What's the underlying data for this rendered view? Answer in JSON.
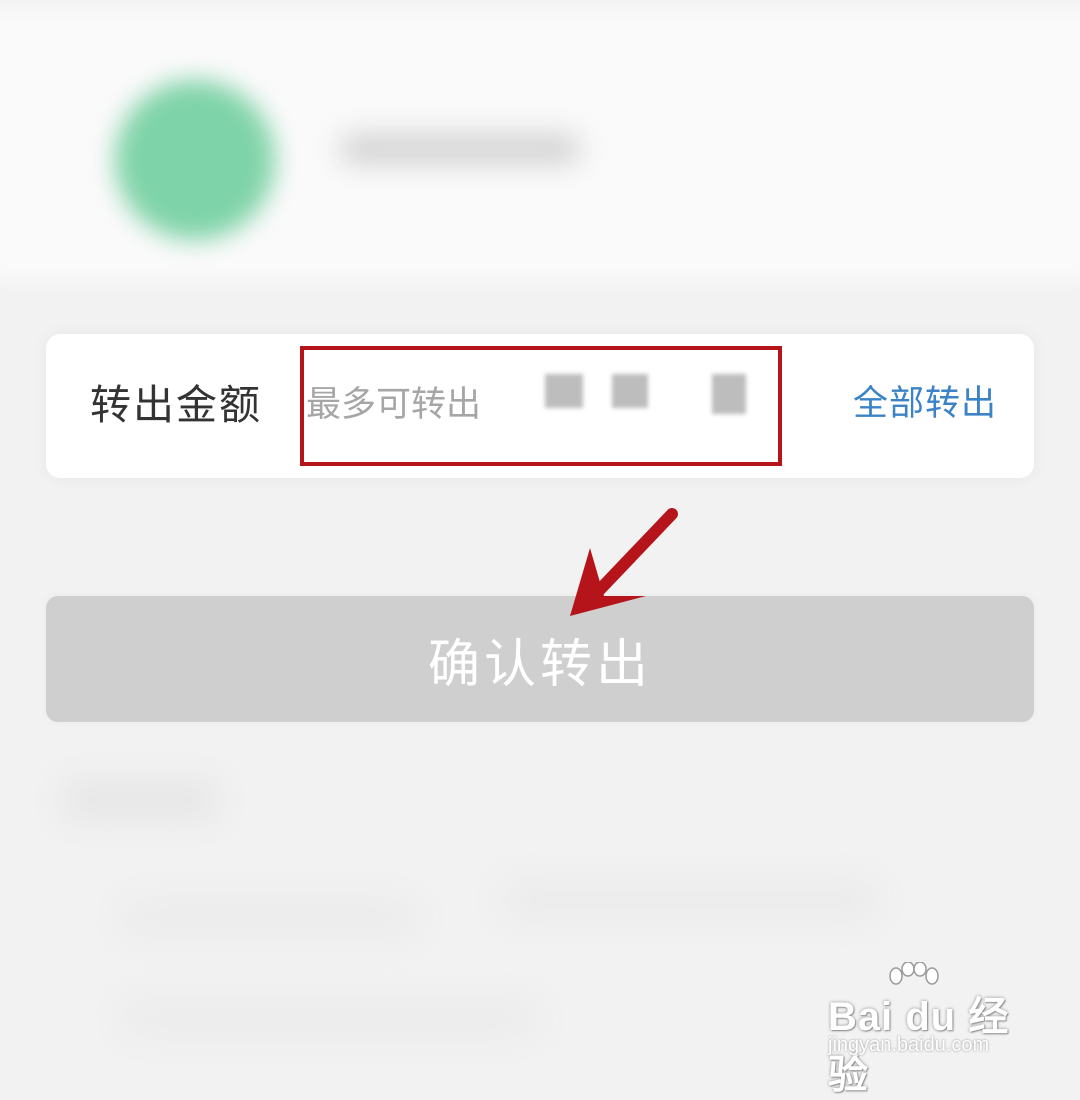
{
  "transfer_form": {
    "amount_label": "转出金额",
    "amount_placeholder": "最多可转出",
    "transfer_all_label": "全部转出",
    "confirm_label": "确认转出"
  },
  "annotation": {
    "highlight_color": "#b5151a",
    "arrow_color": "#b5151a",
    "arrow_target": "confirm-button"
  },
  "watermark": {
    "brand": "Bai du 经验",
    "subtitle": "jingyan.baidu.com"
  },
  "colors": {
    "avatar": "#7fd3a8",
    "link": "#3b83c6",
    "confirm_button_disabled": "#cfcfcf"
  }
}
